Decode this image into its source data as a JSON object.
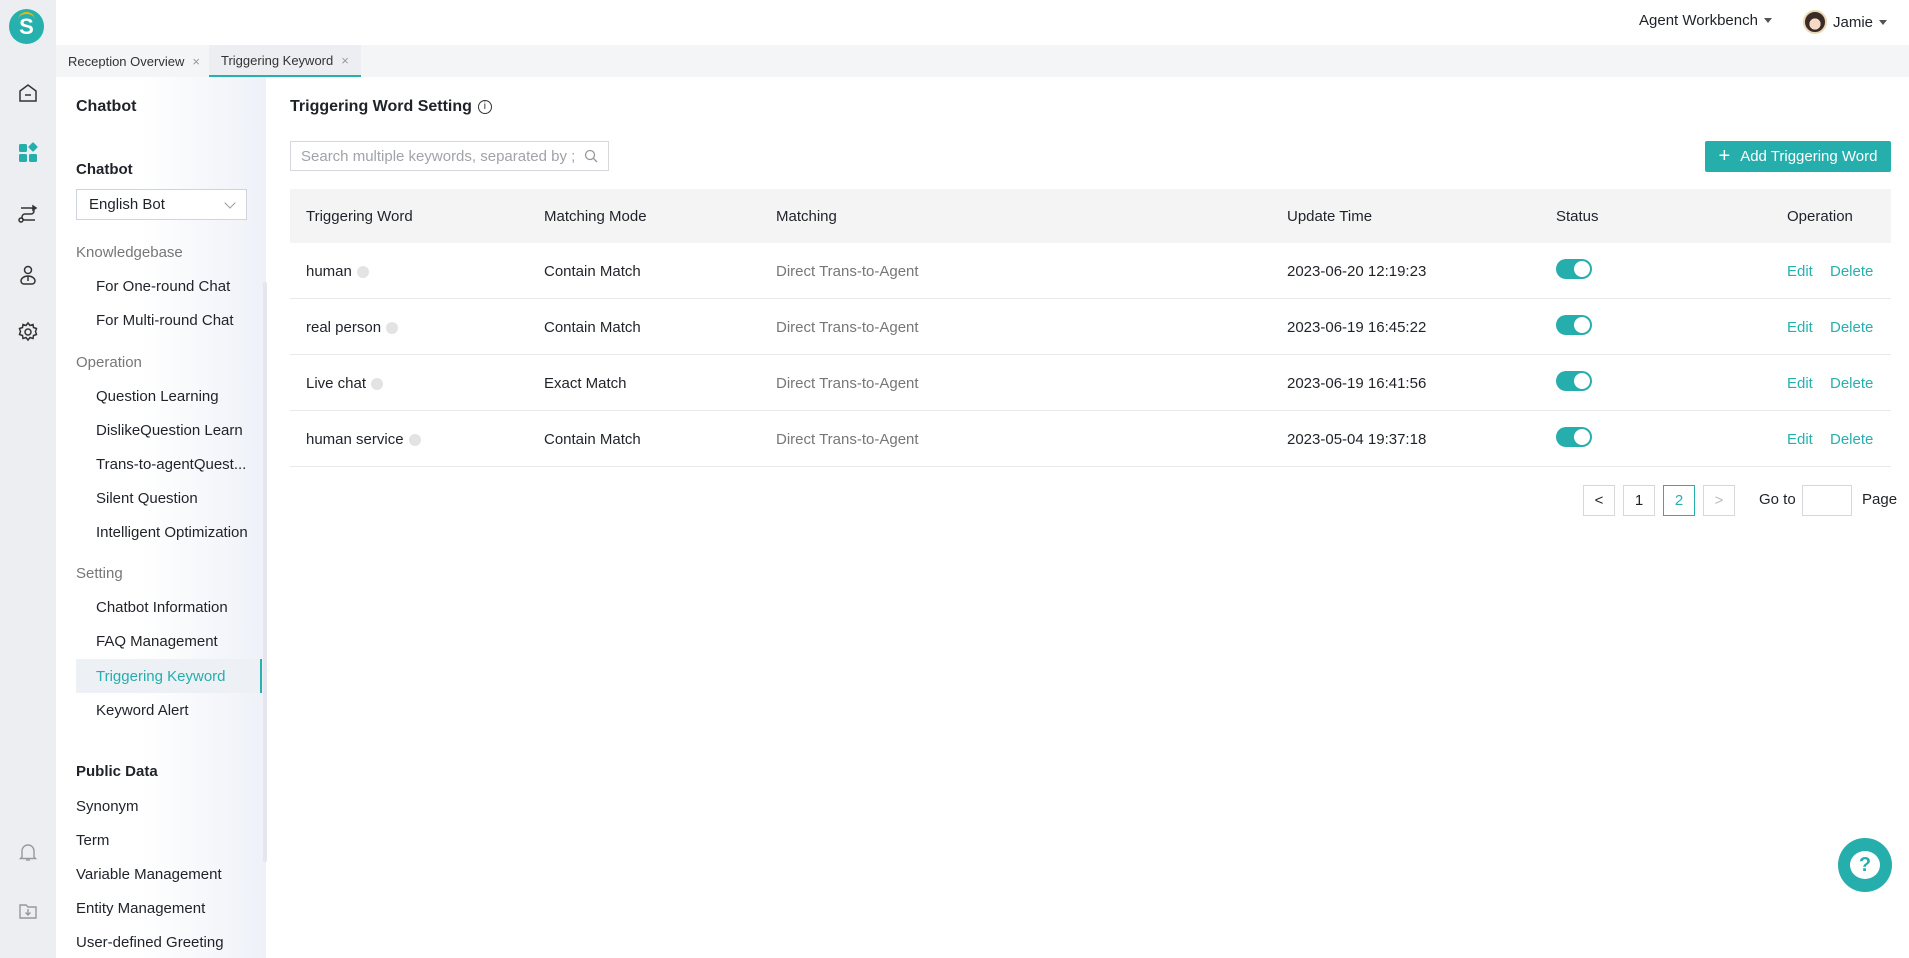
{
  "brand": {
    "logo_letter": "S",
    "accent": "#26aeac"
  },
  "rail": {
    "icons": [
      "home-icon",
      "apps-icon",
      "route-icon",
      "agent-icon",
      "gear-icon",
      "bell-icon",
      "download-folder-icon"
    ]
  },
  "header": {
    "workbench": "Agent Workbench",
    "user": "Jamie"
  },
  "tabs": [
    {
      "label": "Reception Overview",
      "close": "×"
    },
    {
      "label": "Triggering Keyword",
      "close": "×",
      "active": true
    }
  ],
  "sidebar": {
    "title": "Chatbot",
    "chatbot_label": "Chatbot",
    "chatbot_select": "English Bot",
    "groups": [
      {
        "label": "Knowledgebase",
        "items": [
          "For One-round Chat",
          "For Multi-round Chat"
        ]
      },
      {
        "label": "Operation",
        "items": [
          "Question Learning",
          "DislikeQuestion Learn",
          "Trans-to-agentQuest...",
          "Silent Question",
          "Intelligent Optimization"
        ]
      },
      {
        "label": "Setting",
        "items": [
          "Chatbot Information",
          "FAQ Management",
          "Triggering Keyword",
          "Keyword Alert"
        ]
      }
    ],
    "active_item": "Triggering Keyword",
    "public_data": {
      "label": "Public Data",
      "items": [
        "Synonym",
        "Term",
        "Variable Management",
        "Entity Management",
        "User-defined Greeting"
      ]
    }
  },
  "main": {
    "title": "Triggering Word Setting",
    "info_icon": "i",
    "search_placeholder": "Search multiple keywords, separated by ;",
    "add_button": "Add Triggering Word",
    "add_icon": "+",
    "columns": [
      "Triggering Word",
      "Matching Mode",
      "Matching",
      "Update Time",
      "Status",
      "Operation"
    ],
    "rows": [
      {
        "word": "human",
        "mode": "Contain Match",
        "matching": "Direct Trans-to-Agent",
        "time": "2023-06-20 12:19:23",
        "status": true,
        "edit": "Edit",
        "delete": "Delete"
      },
      {
        "word": "real person",
        "mode": "Contain Match",
        "matching": "Direct Trans-to-Agent",
        "time": "2023-06-19 16:45:22",
        "status": true,
        "edit": "Edit",
        "delete": "Delete"
      },
      {
        "word": "Live chat",
        "mode": "Exact Match",
        "matching": "Direct Trans-to-Agent",
        "time": "2023-06-19 16:41:56",
        "status": true,
        "edit": "Edit",
        "delete": "Delete"
      },
      {
        "word": "human service",
        "mode": "Contain Match",
        "matching": "Direct Trans-to-Agent",
        "time": "2023-05-04 19:37:18",
        "status": true,
        "edit": "Edit",
        "delete": "Delete"
      }
    ],
    "pagination": {
      "prev": "<",
      "pages": [
        "1",
        "2"
      ],
      "current": "2",
      "next": ">",
      "goto_label": "Go to",
      "goto_value": "",
      "page_label": "Page"
    }
  },
  "help": {
    "label": "?"
  }
}
